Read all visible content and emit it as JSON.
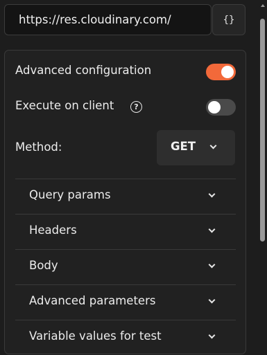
{
  "url_bar": {
    "value": "https://res.cloudinary.com/",
    "braces_label": "{}"
  },
  "config": {
    "advanced_configuration": {
      "label": "Advanced configuration",
      "enabled": true
    },
    "execute_on_client": {
      "label": "Execute on client",
      "help_glyph": "?",
      "enabled": false
    },
    "method": {
      "label": "Method:",
      "value": "GET"
    }
  },
  "sections": [
    {
      "label": "Query params"
    },
    {
      "label": "Headers"
    },
    {
      "label": "Body"
    },
    {
      "label": "Advanced parameters"
    },
    {
      "label": "Variable values for test"
    }
  ],
  "colors": {
    "accent": "#f2693a",
    "background": "#1d1d1d",
    "panel": "#212121"
  },
  "icons": {
    "braces": "code-braces-icon",
    "help": "question-circle-icon",
    "chevron": "chevron-down-icon"
  }
}
